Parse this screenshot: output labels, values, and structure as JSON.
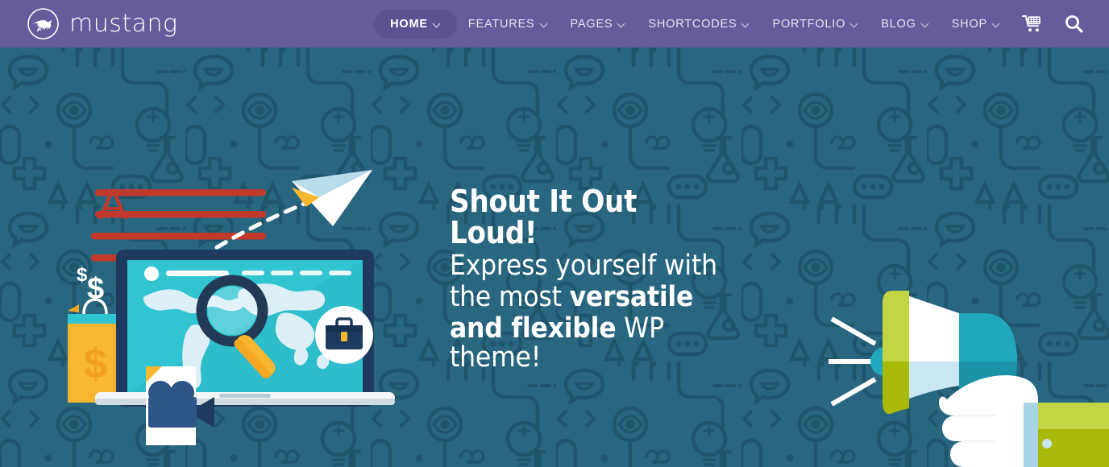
{
  "site": {
    "brand_name": "mustang",
    "logo_icon": "mustang-horse-icon"
  },
  "header": {
    "background_color": "#665c9c",
    "active_item_color": "#5c5292",
    "nav_items": [
      {
        "label": "HOME",
        "has_caret": true,
        "active": true
      },
      {
        "label": "FEATURES",
        "has_caret": true,
        "active": false
      },
      {
        "label": "PAGES",
        "has_caret": true,
        "active": false
      },
      {
        "label": "SHORTCODES",
        "has_caret": true,
        "active": false
      },
      {
        "label": "PORTFOLIO",
        "has_caret": true,
        "active": false
      },
      {
        "label": "BLOG",
        "has_caret": true,
        "active": false
      },
      {
        "label": "SHOP",
        "has_caret": true,
        "active": false
      }
    ],
    "cart_icon": "shopping-cart-icon",
    "search_icon": "search-icon"
  },
  "hero": {
    "background_color": "#2a6781",
    "pattern_color": "#1f5469",
    "headline": {
      "line1": "Shout It Out Loud!",
      "line2": "Express yourself with",
      "line3_plain": "the most ",
      "line3_bold": "versatile",
      "line4_bold": "and flexible",
      "line4_plain": " WP theme!"
    },
    "illustration_left": {
      "name": "laptop-world-map-search-illustration",
      "elements": [
        "laptop",
        "world-map",
        "magnifying-glass",
        "paper-airplane",
        "dashed-flight-path",
        "red-text-lines",
        "letter-A",
        "dollar-signs",
        "shopping-bag",
        "video-camera",
        "document",
        "briefcase-badge"
      ],
      "colors": {
        "laptop_body": "#1e3a5f",
        "screen": "#31c5d2",
        "map": "#d8eef5",
        "accent_orange": "#f5a623",
        "accent_red": "#c0392b",
        "accent_yellow": "#f7b731"
      }
    },
    "illustration_right": {
      "name": "megaphone-in-hand-illustration",
      "elements": [
        "megaphone",
        "hand",
        "sleeve",
        "sound-waves"
      ],
      "colors": {
        "megaphone_lime": "#c3d545",
        "megaphone_lime_dark": "#a8b908",
        "megaphone_teal": "#21a8bd",
        "megaphone_teal_dark": "#1d93a7",
        "hand_white": "#ffffff",
        "cuff_blue": "#a8d5e5"
      }
    }
  }
}
